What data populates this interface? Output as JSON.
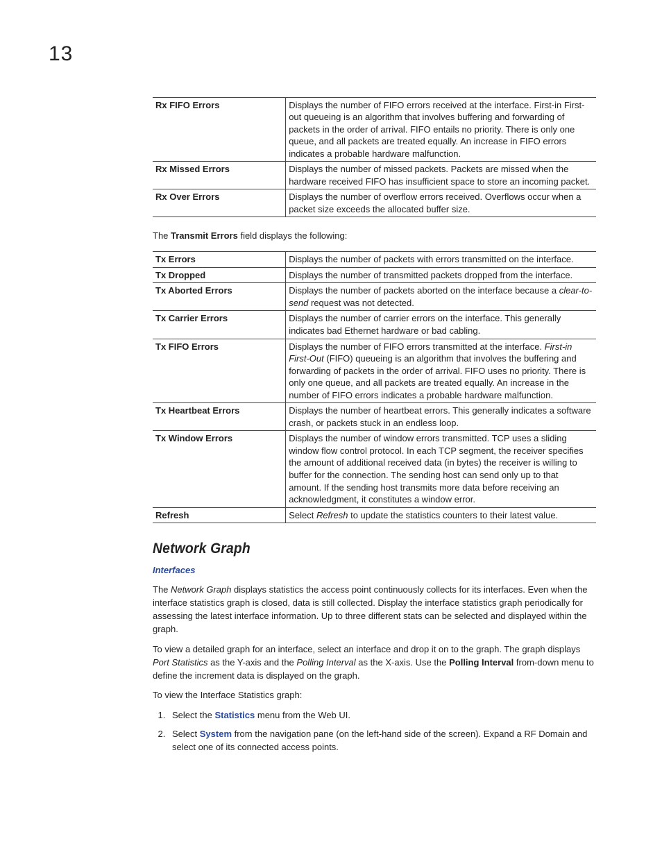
{
  "chapter_number": "13",
  "table1": {
    "rows": [
      {
        "name": "Rx FIFO Errors",
        "desc": "Displays the number of FIFO errors received at the interface. First-in First-out queueing is an algorithm that involves buffering and forwarding of packets in the order of arrival. FIFO entails no priority. There is only one queue, and all packets are treated equally. An increase in FIFO errors indicates a probable hardware malfunction."
      },
      {
        "name": "Rx Missed Errors",
        "desc": "Displays the number of missed packets. Packets are missed when the hardware received FIFO has insufficient space to store an incoming packet."
      },
      {
        "name": "Rx Over Errors",
        "desc": "Displays the number of overflow errors received. Overflows occur when a packet size exceeds the allocated buffer size."
      }
    ]
  },
  "transmit_intro": {
    "pre": "The ",
    "bold": "Transmit Errors",
    "post": " field displays the following:"
  },
  "table2": {
    "rows": [
      {
        "name": "Tx Errors",
        "desc_parts": [
          {
            "t": "Displays the number of packets with errors transmitted on the interface."
          }
        ]
      },
      {
        "name": "Tx Dropped",
        "desc_parts": [
          {
            "t": "Displays the number of transmitted packets dropped from the interface."
          }
        ]
      },
      {
        "name": "Tx Aborted Errors",
        "desc_parts": [
          {
            "t": "Displays the number of packets aborted on the interface because a "
          },
          {
            "t": "clear-to-send",
            "i": true
          },
          {
            "t": " request was not detected."
          }
        ]
      },
      {
        "name": "Tx Carrier Errors",
        "desc_parts": [
          {
            "t": "Displays the number of carrier errors on the interface. This generally indicates bad Ethernet hardware or bad cabling."
          }
        ]
      },
      {
        "name": "Tx FIFO Errors",
        "desc_parts": [
          {
            "t": "Displays the number of FIFO errors transmitted at the interface. "
          },
          {
            "t": "First-in First-Out",
            "i": true
          },
          {
            "t": " (FIFO) queueing is an algorithm that involves the buffering and forwarding of packets in the order of arrival. FIFO uses no priority. There is only one queue, and all packets are treated equally. An increase in the number of FIFO errors indicates a probable hardware malfunction."
          }
        ]
      },
      {
        "name": "Tx Heartbeat Errors",
        "desc_parts": [
          {
            "t": "Displays the number of heartbeat errors. This generally indicates a software crash, or packets stuck in an endless loop."
          }
        ]
      },
      {
        "name": "Tx Window Errors",
        "desc_parts": [
          {
            "t": "Displays the number of window errors transmitted. TCP uses a sliding window flow control protocol. In each TCP segment, the receiver specifies the amount of additional received data (in bytes) the receiver is willing to buffer for the connection. The sending host can send only up to that amount. If the sending host transmits more data before receiving an acknowledgment, it constitutes a window error."
          }
        ]
      },
      {
        "name": "Refresh",
        "desc_parts": [
          {
            "t": "Select "
          },
          {
            "t": "Refresh",
            "i": true
          },
          {
            "t": " to update the statistics counters to their latest value."
          }
        ]
      }
    ]
  },
  "section_heading": "Network Graph",
  "subheading_link": "Interfaces",
  "para1_parts": [
    {
      "t": "The "
    },
    {
      "t": "Network Graph",
      "i": true
    },
    {
      "t": " displays statistics the access point continuously collects for its interfaces. Even when the interface statistics graph is closed, data is still collected. Display the interface statistics graph periodically for assessing the latest interface information. Up to three different stats can be selected and displayed within the graph."
    }
  ],
  "para2_parts": [
    {
      "t": "To view a detailed graph for an interface, select an interface and drop it on to the graph. The graph displays "
    },
    {
      "t": "Port Statistics",
      "i": true
    },
    {
      "t": " as the Y-axis and the "
    },
    {
      "t": "Polling Interval",
      "i": true
    },
    {
      "t": " as the X-axis. Use the "
    },
    {
      "t": "Polling Interval",
      "b": true
    },
    {
      "t": " from-down menu to define the increment data is displayed on the graph."
    }
  ],
  "para3": "To view the Interface Statistics graph:",
  "steps": [
    {
      "parts": [
        {
          "t": "Select the "
        },
        {
          "t": "Statistics",
          "lb": true
        },
        {
          "t": " menu from the Web UI."
        }
      ]
    },
    {
      "parts": [
        {
          "t": "Select "
        },
        {
          "t": "System",
          "lb": true
        },
        {
          "t": " from the navigation pane (on the left-hand side of the screen). Expand a RF Domain and select one of its connected access points."
        }
      ]
    }
  ]
}
